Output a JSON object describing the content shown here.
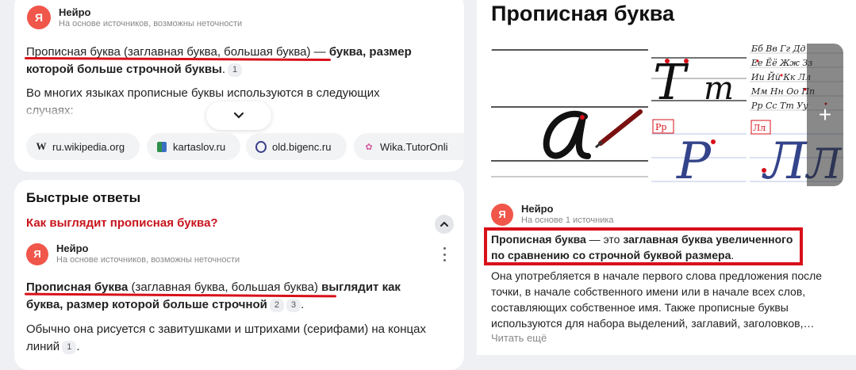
{
  "left_card1": {
    "source_name": "Нейро",
    "source_sub": "На основе источников, возможны неточности",
    "p1_underlined": "Прописная буква (заглавная буква, большая буква)",
    "p1_dash": " — ",
    "p1_bold": "буква, размер которой больше строчной буквы",
    "p1_end": ".",
    "p1_cite": "1",
    "p2": "Во многих языках прописные буквы используются в следующих случаях:",
    "chips": [
      {
        "icon": "wikipedia-icon",
        "label": "ru.wikipedia.org"
      },
      {
        "icon": "book-icon",
        "label": "kartaslov.ru"
      },
      {
        "icon": "globe-icon",
        "label": "old.bigenc.ru"
      },
      {
        "icon": "flower-icon",
        "label": "Wika.TutorOnli"
      }
    ]
  },
  "quick": {
    "title": "Быстрые ответы",
    "question": "Как выглядит прописная буква?",
    "source_name": "Нейро",
    "source_sub": "На основе источников, возможны неточности",
    "p1_bold_underlined": "Прописная буква",
    "p1_underlined": " (заглавная буква, большая буква)",
    "p1_bold": " выглядит как буква, размер которой больше строчной",
    "p1_cites": [
      "2",
      "3"
    ],
    "p1_end": ".",
    "p2": "Обычно она рисуется с завитушками и штрихами (серифами) на концах линий",
    "p2_cite": "1",
    "p2_end": "."
  },
  "right": {
    "title": "Прописная буква",
    "images_letters": {
      "big": "a",
      "t_upper": "Т",
      "t_lower": "т",
      "r_label": "Рр",
      "r_big": "Р",
      "l_label": "Лл",
      "l_big": "Л"
    },
    "source_name": "Нейро",
    "source_sub": "На основе 1 источника",
    "box_bold1": "Прописная буква",
    "box_plain1": " — это ",
    "box_bold2": "заглавная буква увеличенного по сравнению со строчной буквой размера",
    "box_end": ".",
    "body": "Она употребляется в начале первого слова предложения после точки, в начале собственного имени или в начале всех слов, составляющих собственное имя. Также прописные буквы используются для набора выделений, заглавий, заголовков,…",
    "read_more": "Читать ещё"
  },
  "colors": {
    "accent_red": "#d8101a",
    "logo": "#f0564a"
  }
}
